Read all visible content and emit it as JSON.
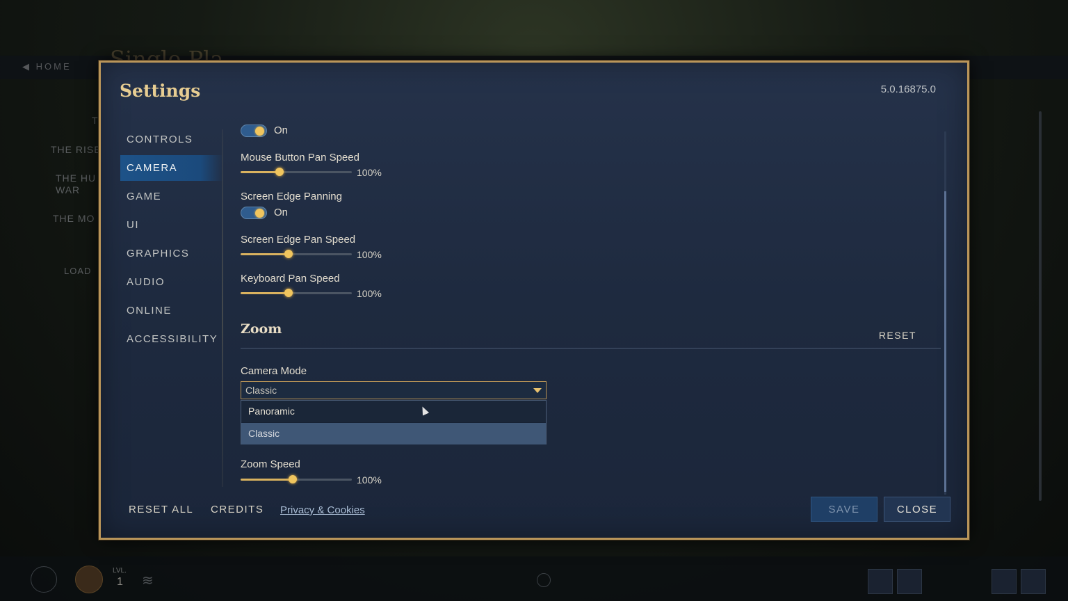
{
  "background": {
    "home_label": "◀ HOME",
    "singleplayer_title": "Single Pla",
    "campaigns": [
      "T",
      "THE RISE",
      "THE HU\nWAR",
      "THE MO",
      "LOAD"
    ],
    "level_label": "LVL.",
    "level_value": "1"
  },
  "dialog": {
    "title": "Settings",
    "version": "5.0.16875.0"
  },
  "nav": {
    "items": [
      {
        "label": "CONTROLS"
      },
      {
        "label": "CAMERA"
      },
      {
        "label": "GAME"
      },
      {
        "label": "UI"
      },
      {
        "label": "GRAPHICS"
      },
      {
        "label": "AUDIO"
      },
      {
        "label": "ONLINE"
      },
      {
        "label": "ACCESSIBILITY"
      }
    ],
    "active": "CAMERA"
  },
  "settings": {
    "top_toggle": {
      "state": "On"
    },
    "mouse_button_pan_speed": {
      "label": "Mouse Button Pan Speed",
      "value_text": "100%",
      "level": 0.35
    },
    "screen_edge_panning": {
      "label": "Screen Edge Panning",
      "state": "On"
    },
    "screen_edge_pan_speed": {
      "label": "Screen Edge Pan Speed",
      "value_text": "100%",
      "level": 0.43
    },
    "keyboard_pan_speed": {
      "label": "Keyboard Pan Speed",
      "value_text": "100%",
      "level": 0.43
    },
    "zoom_section": {
      "title": "Zoom",
      "reset_label": "RESET"
    },
    "camera_mode": {
      "label": "Camera Mode",
      "selected": "Classic",
      "options": [
        "Panoramic",
        "Classic"
      ],
      "highlighted": "Classic"
    },
    "zoom_speed": {
      "label": "Zoom Speed",
      "value_text": "100%",
      "level": 0.47
    }
  },
  "footer": {
    "reset_all": "RESET ALL",
    "credits": "CREDITS",
    "privacy": "Privacy & Cookies",
    "save": "SAVE",
    "close": "CLOSE"
  },
  "colors": {
    "frame_gold": "#b9955a",
    "accent_blue": "#1d5288",
    "slider_gold": "#f0c55e",
    "panel_bg": "#1e2a3f"
  }
}
